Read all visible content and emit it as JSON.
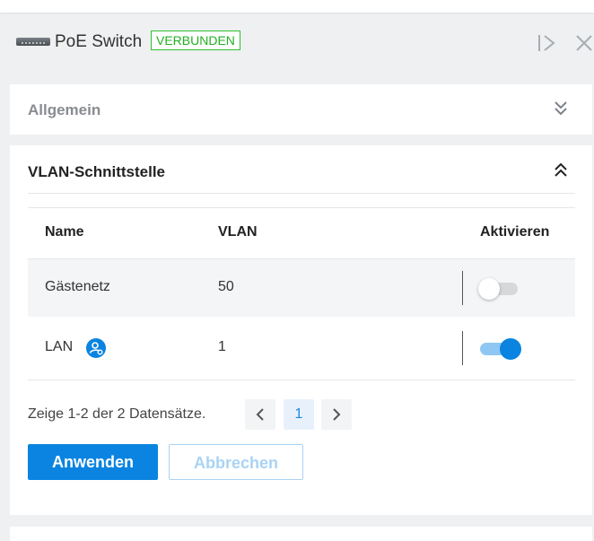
{
  "header": {
    "device_title": "PoE Switch",
    "status_badge": "VERBUNDEN",
    "icons": {
      "device": "switch-device-icon",
      "collapse": "collapse-panel-icon",
      "close": "close-icon"
    }
  },
  "general_section": {
    "title": "Allgemein",
    "state": "collapsed"
  },
  "vlan_section": {
    "title": "VLAN-Schnittstelle",
    "state": "expanded",
    "columns": [
      "Name",
      "VLAN",
      "Aktivieren"
    ],
    "rows": [
      {
        "name": "Gästenetz",
        "vlan": "50",
        "enabled": false,
        "has_icon": false
      },
      {
        "name": "LAN",
        "vlan": "1",
        "enabled": true,
        "has_icon": true,
        "icon": "user-network-icon"
      }
    ]
  },
  "pagination": {
    "summary": "Zeige 1-2 der 2 Datensätze.",
    "current_page": "1"
  },
  "buttons": {
    "apply": "Anwenden",
    "cancel": "Abbrechen"
  },
  "colors": {
    "accent": "#0a84e0",
    "badge_green": "#22b022",
    "toggle_off": "#d6d8da",
    "toggle_on_track": "#8ec7f3"
  }
}
